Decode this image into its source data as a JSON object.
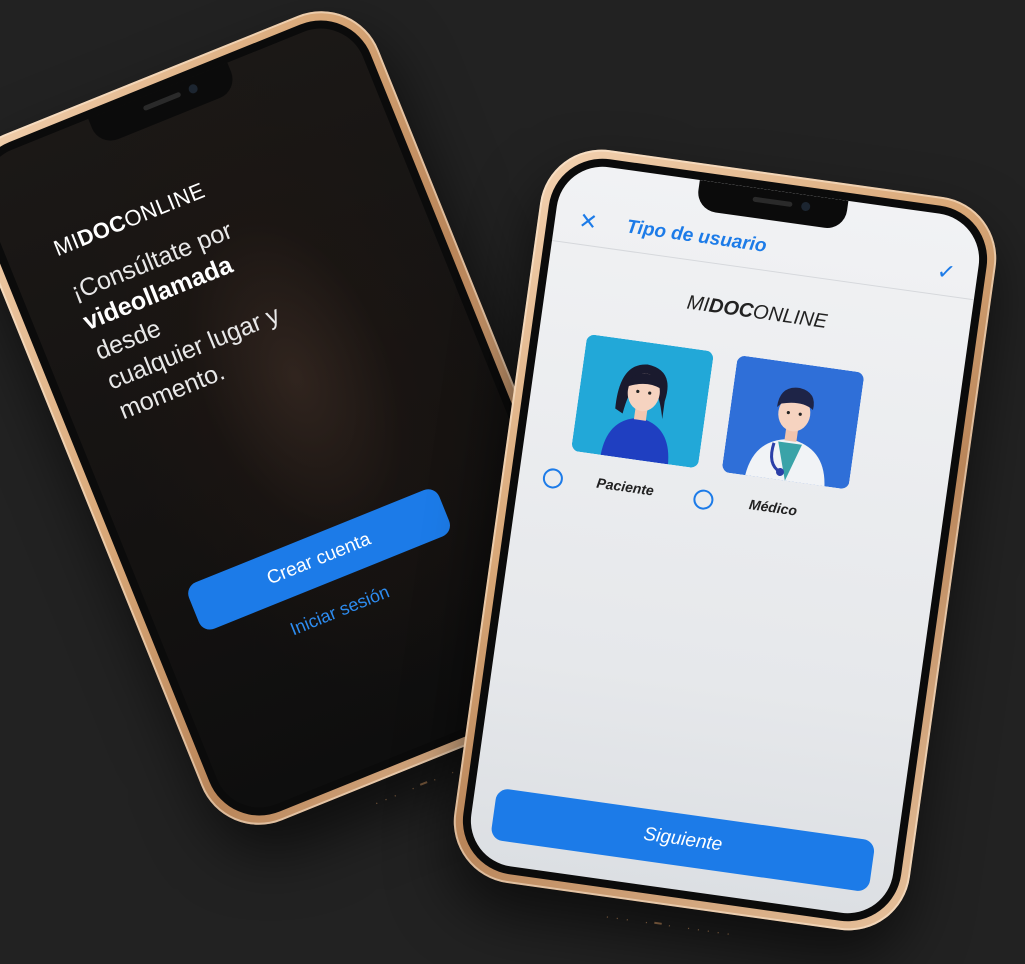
{
  "background_color": "#222222",
  "accent_color": "#1c7be8",
  "phone_left": {
    "brand": {
      "prefix": "MI",
      "bold": "DOC",
      "suffix": "ONLINE"
    },
    "headline": {
      "line1": "¡Consúltate por",
      "bold": "videollamada",
      "line2_rest": " desde",
      "line3": "cualquier lugar y",
      "line4": "momento."
    },
    "primary_button_label": "Crear cuenta",
    "secondary_link_label": "Iniciar sesión"
  },
  "phone_right": {
    "header": {
      "close_icon": "close-icon",
      "title": "Tipo de usuario",
      "confirm_icon": "check-icon"
    },
    "brand": {
      "prefix": "MI",
      "bold": "DOC",
      "suffix": "ONLINE"
    },
    "options": [
      {
        "label": "Paciente",
        "selected": false,
        "illustration": "patient-illustration"
      },
      {
        "label": "Médico",
        "selected": false,
        "illustration": "doctor-illustration"
      }
    ],
    "next_button_label": "Siguiente"
  }
}
